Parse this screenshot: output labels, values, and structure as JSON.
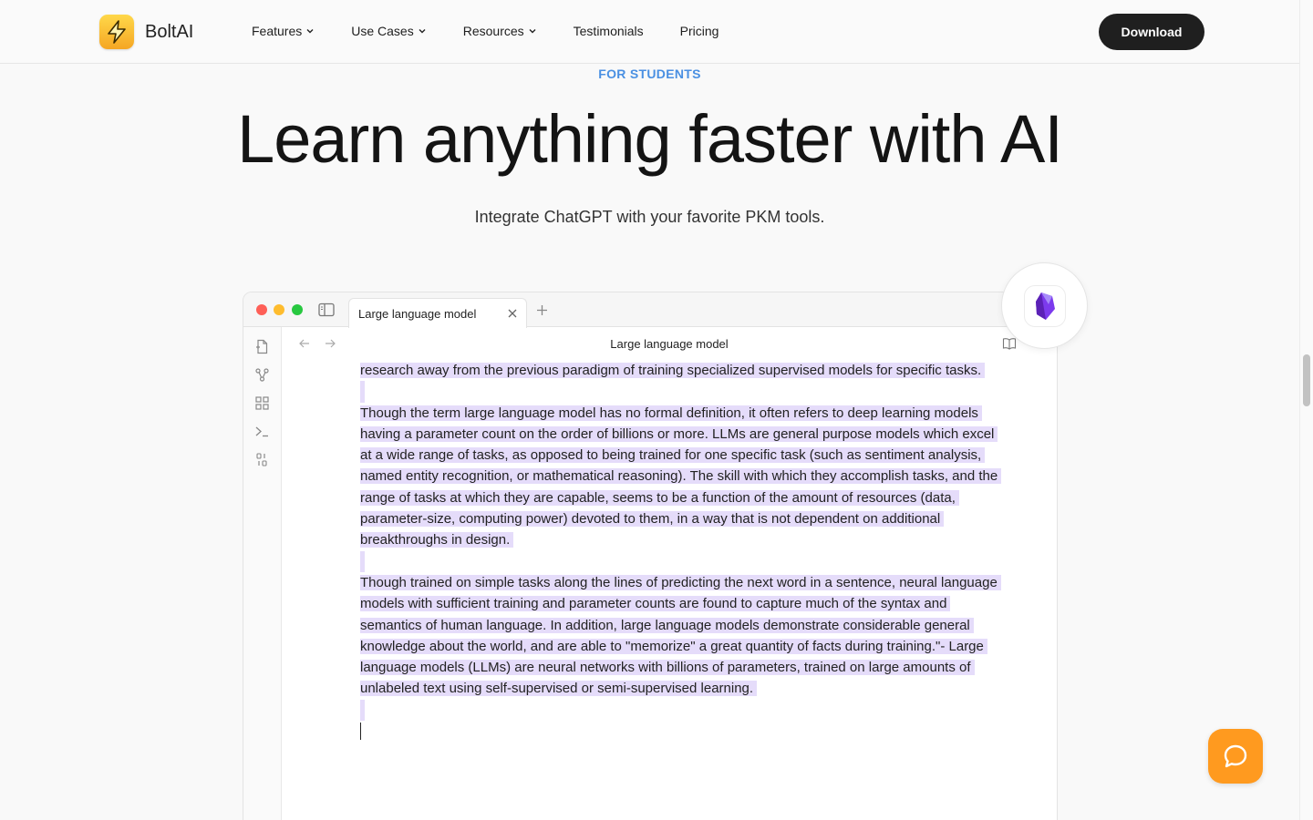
{
  "header": {
    "brand": "BoltAI",
    "nav": [
      {
        "label": "Features",
        "dropdown": true
      },
      {
        "label": "Use Cases",
        "dropdown": true
      },
      {
        "label": "Resources",
        "dropdown": true
      },
      {
        "label": "Testimonials",
        "dropdown": false
      },
      {
        "label": "Pricing",
        "dropdown": false
      }
    ],
    "download_label": "Download"
  },
  "hero": {
    "eyebrow": "FOR STUDENTS",
    "title": "Learn anything faster with AI",
    "subtitle": "Integrate ChatGPT with your favorite PKM tools."
  },
  "app": {
    "tab_label": "Large language model",
    "doc_title": "Large language model",
    "paragraphs": [
      "research away from the previous paradigm of training specialized supervised models for specific tasks.",
      "Though the term large language model has no formal definition, it often refers to deep learning models having a parameter count on the order of billions or more. LLMs are general purpose models which excel at a wide range of tasks, as opposed to being trained for one specific task (such as sentiment analysis, named entity recognition, or mathematical reasoning). The skill with which they accomplish tasks, and the range of tasks at which they are capable, seems to be a function of the amount of resources (data, parameter-size, computing power) devoted to them, in a way that is not dependent on additional breakthroughs in design.",
      "Though trained on simple tasks along the lines of predicting the next word in a sentence, neural language models with sufficient training and parameter counts are found to capture much of the syntax and semantics of human language. In addition, large language models demonstrate considerable general knowledge about the world, and are able to \"memorize\" a great quantity of facts during training.\"- Large language models (LLMs) are neural networks with billions of parameters, trained on large amounts of unlabeled text using self-supervised or semi-supervised learning."
    ]
  },
  "colors": {
    "accent": "#4a90e2",
    "highlight": "#e5dcfa",
    "help_button": "#ff9a1f",
    "download_button": "#1f1f1f"
  },
  "icons": [
    "bolt-logo-icon",
    "chevron-down-icon",
    "sidebar-toggle-icon",
    "close-icon",
    "plus-icon",
    "file-icon",
    "graph-icon",
    "grid-icon",
    "terminal-icon",
    "binary-icon",
    "arrow-left-icon",
    "arrow-right-icon",
    "book-icon",
    "obsidian-icon",
    "chat-bubble-icon"
  ]
}
